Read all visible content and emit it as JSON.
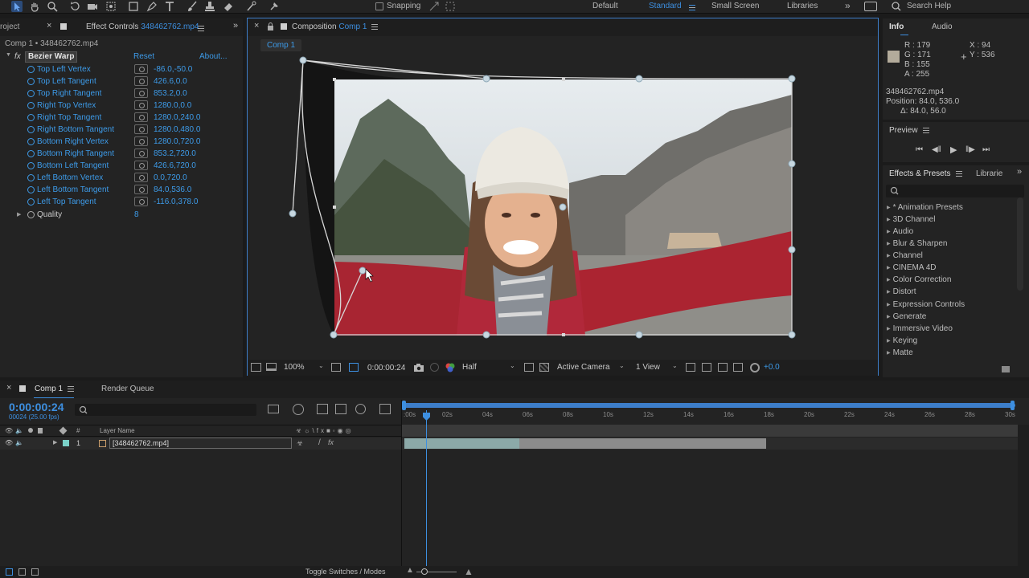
{
  "toolbar": {
    "tools": [
      "selection-tool-icon",
      "hand-tool-icon",
      "zoom-tool-icon",
      "rotate-tool-icon",
      "camera-tool-icon",
      "pan-behind-icon",
      "rectangle-tool-icon",
      "pen-tool-icon",
      "type-tool-icon",
      "brush-tool-icon",
      "clone-stamp-icon",
      "eraser-icon",
      "roto-brush-icon",
      "puppet-pin-icon"
    ],
    "snapping_label": "Snapping",
    "workspaces": [
      "Default",
      "Standard",
      "Small Screen",
      "Libraries"
    ],
    "active_workspace": "Standard",
    "search_placeholder": "Search Help"
  },
  "effect_controls": {
    "project_tab": "roject",
    "tab_label": "Effect Controls",
    "tab_file": "348462762.mp4",
    "header": "Comp 1 • 348462762.mp4",
    "effect_name": "Bezier Warp",
    "reset_label": "Reset",
    "about_label": "About...",
    "fx_label": "fx",
    "params": [
      {
        "name": "Top Left Vertex",
        "value": "-86.0,-50.0"
      },
      {
        "name": "Top Left Tangent",
        "value": "426.6,0.0"
      },
      {
        "name": "Top Right Tangent",
        "value": "853.2,0.0"
      },
      {
        "name": "Right Top Vertex",
        "value": "1280.0,0.0"
      },
      {
        "name": "Right Top Tangent",
        "value": "1280.0,240.0"
      },
      {
        "name": "Right Bottom Tangent",
        "value": "1280.0,480.0"
      },
      {
        "name": "Bottom Right Vertex",
        "value": "1280.0,720.0"
      },
      {
        "name": "Bottom Right Tangent",
        "value": "853.2,720.0"
      },
      {
        "name": "Bottom Left Tangent",
        "value": "426.6,720.0"
      },
      {
        "name": "Left Bottom Vertex",
        "value": "0.0,720.0"
      },
      {
        "name": "Left Bottom Tangent",
        "value": "84.0,536.0"
      },
      {
        "name": "Left Top Tangent",
        "value": "-116.0,378.0"
      }
    ],
    "quality_label": "Quality",
    "quality_value": "8"
  },
  "composition": {
    "tab_prefix": "Composition",
    "tab_name": "Comp 1",
    "subtab": "Comp 1",
    "zoom": "100%",
    "timecode": "0:00:00:24",
    "resolution": "Half",
    "camera": "Active Camera",
    "views": "1 View",
    "exposure": "+0.0"
  },
  "info": {
    "tab_info": "Info",
    "tab_audio": "Audio",
    "r": "R : 179",
    "g": "G : 171",
    "b": "B : 155",
    "a": "A : 255",
    "x": "X : 94",
    "y": "Y : 536",
    "swatch_color": "#b3ab9b",
    "file": "348462762.mp4",
    "position": "Position: 84.0, 536.0",
    "delta": "Δ: 84.0, 56.0"
  },
  "preview": {
    "label": "Preview"
  },
  "effects_presets": {
    "tab_label": "Effects & Presets",
    "tab2_label": "Librarie",
    "search_placeholder": "",
    "categories": [
      "* Animation Presets",
      "3D Channel",
      "Audio",
      "Blur & Sharpen",
      "Channel",
      "CINEMA 4D",
      "Color Correction",
      "Distort",
      "Expression Controls",
      "Generate",
      "Immersive Video",
      "Keying",
      "Matte"
    ]
  },
  "timeline": {
    "tab_comp": "Comp 1",
    "tab_render": "Render Queue",
    "timecode": "0:00:00:24",
    "frames_info": "00024 (25.00 fps)",
    "col_hash": "#",
    "col_layer_name": "Layer Name",
    "layer_number": "1",
    "layer_name": "[348462762.mp4]",
    "ruler_labels": [
      ":00s",
      "02s",
      "04s",
      "06s",
      "08s",
      "10s",
      "12s",
      "14s",
      "16s",
      "18s",
      "20s",
      "22s",
      "24s",
      "26s",
      "28s",
      "30s"
    ],
    "toggle_label": "Toggle Switches / Modes",
    "colors": {
      "accent": "#3d8fe0",
      "layer_bar": "#8ca9a8",
      "layer_label": "#7ad1c8"
    }
  }
}
